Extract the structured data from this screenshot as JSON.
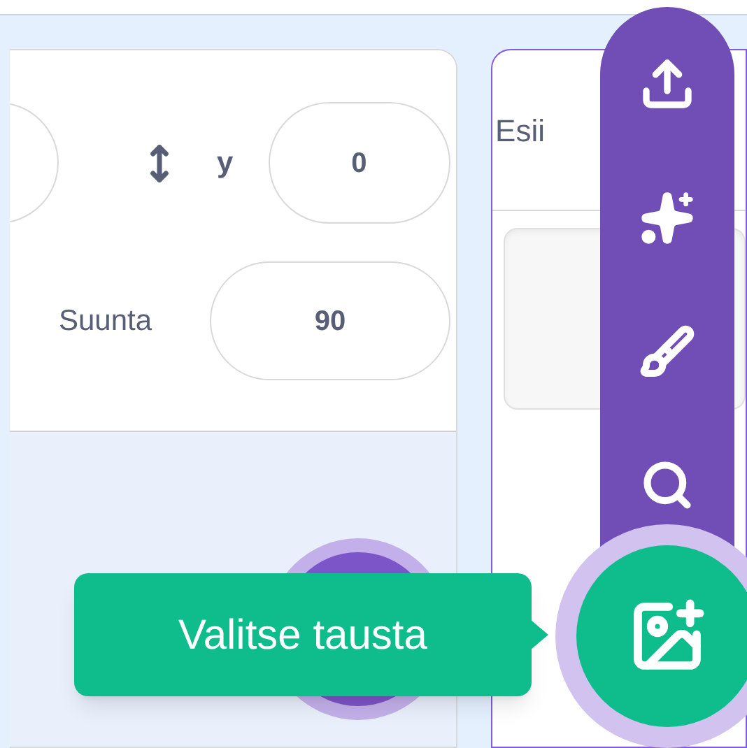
{
  "sprite_info": {
    "y_label": "y",
    "y_value": "0",
    "direction_label": "Suunta",
    "direction_value": "90"
  },
  "stage_panel": {
    "title": "Esii"
  },
  "backdrop_menu": {
    "expanded": true
  },
  "tooltip": "Valitse tausta"
}
